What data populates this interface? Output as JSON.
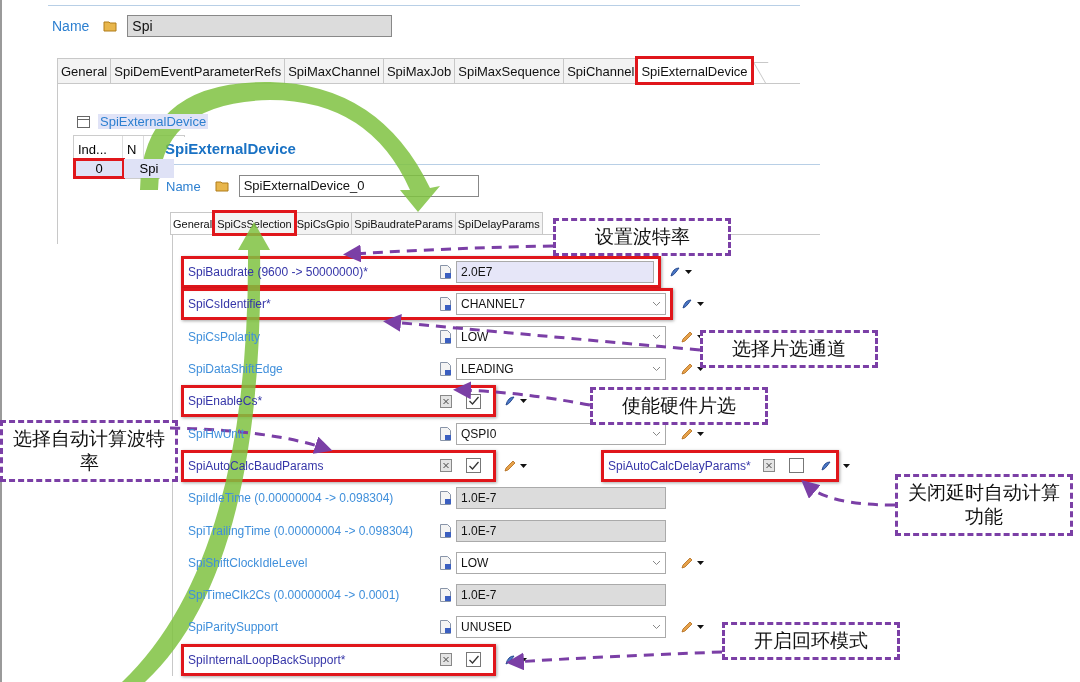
{
  "name_field": {
    "label": "Name",
    "value": "Spi"
  },
  "tabs": [
    {
      "label": "General",
      "selected": false,
      "highlighted": false
    },
    {
      "label": "SpiDemEventParameterRefs",
      "selected": false,
      "highlighted": false
    },
    {
      "label": "SpiMaxChannel",
      "selected": false,
      "highlighted": false
    },
    {
      "label": "SpiMaxJob",
      "selected": false,
      "highlighted": false
    },
    {
      "label": "SpiMaxSequence",
      "selected": false,
      "highlighted": false
    },
    {
      "label": "SpiChannel",
      "selected": false,
      "highlighted": false
    },
    {
      "label": "SpiExternalDevice",
      "selected": true,
      "highlighted": true
    }
  ],
  "table_section": {
    "title": "SpiExternalDevice",
    "columns": [
      "Ind...",
      "N"
    ],
    "rows": [
      {
        "cells": [
          "0",
          "Spi"
        ],
        "selected": true,
        "highlighted": true
      }
    ]
  },
  "detail": {
    "title": "SpiExternalDevice",
    "name_field": {
      "label": "Name",
      "value": "SpiExternalDevice_0"
    },
    "tabs": [
      {
        "label": "General",
        "selected": true,
        "highlighted": false
      },
      {
        "label": "SpiCsSelection",
        "selected": false,
        "highlighted": true
      },
      {
        "label": "SpiCsGpio",
        "selected": false,
        "highlighted": false
      },
      {
        "label": "SpiBaudrateParams",
        "selected": false,
        "highlighted": false
      },
      {
        "label": "SpiDelayParams",
        "selected": false,
        "highlighted": false
      }
    ],
    "params": [
      {
        "kind": "text",
        "label": "SpiBaudrate (9600 -> 50000000)*",
        "value": "2.0E7",
        "configured": true,
        "highlighted": true,
        "tool": {
          "kind": "reset"
        }
      },
      {
        "kind": "combo",
        "label": "SpiCsIdentifier*",
        "value": "CHANNEL7",
        "configured": true,
        "highlighted": true,
        "tool": {
          "kind": "reset"
        }
      },
      {
        "kind": "combo",
        "label": "SpiCsPolarity",
        "value": "LOW",
        "configured": false,
        "highlighted": false,
        "tool": {
          "kind": "edit"
        }
      },
      {
        "kind": "combo",
        "label": "SpiDataShiftEdge",
        "value": "LEADING",
        "configured": false,
        "highlighted": false,
        "tool": {
          "kind": "edit"
        }
      },
      {
        "kind": "check",
        "label": "SpiEnableCs*",
        "checked": true,
        "configured": true,
        "highlighted": true,
        "tool": {
          "kind": "reset"
        }
      },
      {
        "kind": "combo",
        "label": "SpiHwUnit",
        "value": "QSPI0",
        "configured": false,
        "highlighted": false,
        "tool": {
          "kind": "edit"
        }
      },
      {
        "kind": "check",
        "label": "SpiAutoCalcBaudParams",
        "checked": true,
        "configured": true,
        "highlighted": true,
        "tool": {
          "kind": "edit"
        },
        "extra": {
          "label": "SpiAutoCalcDelayParams*",
          "checked": false,
          "configured": true,
          "highlighted": true,
          "tool": {
            "kind": "reset"
          }
        }
      },
      {
        "kind": "readonly",
        "label": "SpiIdleTime (0.00000004 -> 0.098304)",
        "value": "1.0E-7",
        "configured": false,
        "highlighted": false
      },
      {
        "kind": "readonly",
        "label": "SpiTrailingTime (0.00000004 -> 0.098304)",
        "value": "1.0E-7",
        "configured": false,
        "highlighted": false
      },
      {
        "kind": "combo",
        "label": "SpiShiftClockIdleLevel",
        "value": "LOW",
        "configured": false,
        "highlighted": false,
        "tool": {
          "kind": "edit"
        }
      },
      {
        "kind": "readonly",
        "label": "SpiTimeClk2Cs (0.00000004 -> 0.0001)",
        "value": "1.0E-7",
        "configured": false,
        "highlighted": false
      },
      {
        "kind": "combo",
        "label": "SpiParitySupport",
        "value": "UNUSED",
        "configured": false,
        "highlighted": false,
        "tool": {
          "kind": "edit"
        }
      },
      {
        "kind": "check",
        "label": "SpiInternalLoopBackSupport*",
        "checked": true,
        "configured": true,
        "highlighted": true,
        "tool": {
          "kind": "reset"
        }
      }
    ]
  },
  "callouts": [
    {
      "text": "设置波特率"
    },
    {
      "text": "选择片选通道"
    },
    {
      "text": "使能硬件片选"
    },
    {
      "text": "选择自动计算波特率"
    },
    {
      "text": "关闭延时自动计算功能"
    },
    {
      "text": "开启回环模式"
    }
  ]
}
